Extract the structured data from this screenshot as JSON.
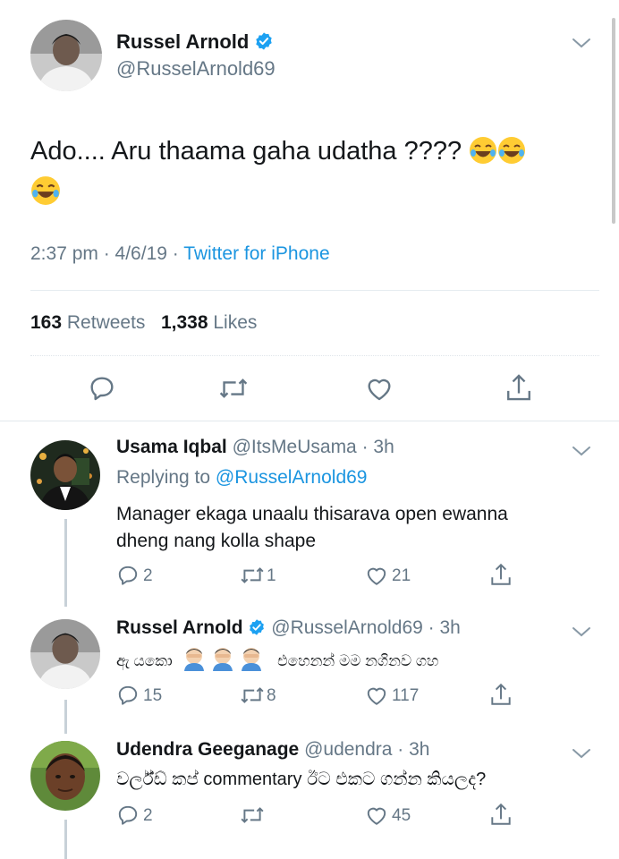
{
  "main_tweet": {
    "author_name": "Russel Arnold",
    "author_handle": "@RusselArnold69",
    "text_line1": "Ado.... Aru thaama gaha udatha ????",
    "time": "2:37 pm · 4/6/19 · ",
    "source": "Twitter for iPhone",
    "retweets_count": "163",
    "retweets_label": "Retweets",
    "likes_count": "1,338",
    "likes_label": "Likes"
  },
  "replies": [
    {
      "name": "Usama Iqbal",
      "handle_time": "@ItsMeUsama · 3h",
      "replying_prefix": "Replying to ",
      "replying_to": "@RusselArnold69",
      "text_line1": "Manager ekaga unaalu thisarava open ewanna",
      "text_line2": "dheng nang kolla shape",
      "reply_count": "2",
      "retweet_count": "1",
      "like_count": "21"
    },
    {
      "name": "Russel Arnold",
      "handle_time": "@RusselArnold69 · 3h",
      "text_a": "ඇ යකො",
      "text_b": "එහෙනන් මම නගිනව ගහ",
      "reply_count": "15",
      "retweet_count": "8",
      "like_count": "117"
    },
    {
      "name": "Udendra Geeganage",
      "handle_time": "@udendra · 3h",
      "text": "වර්ල්ඩ් කප් commentary ඊට එකට ගන්න කියලද?",
      "reply_count": "2",
      "retweet_count": "",
      "like_count": "45"
    }
  ],
  "colors": {
    "accent": "#1b95e0",
    "secondary_text": "#657786",
    "icon": "#657786",
    "verified": "#1da1f2"
  },
  "icons": [
    "chevron-down-icon",
    "verified-badge-icon",
    "reply-icon",
    "retweet-icon",
    "like-icon",
    "share-icon",
    "laughing-emoji"
  ]
}
